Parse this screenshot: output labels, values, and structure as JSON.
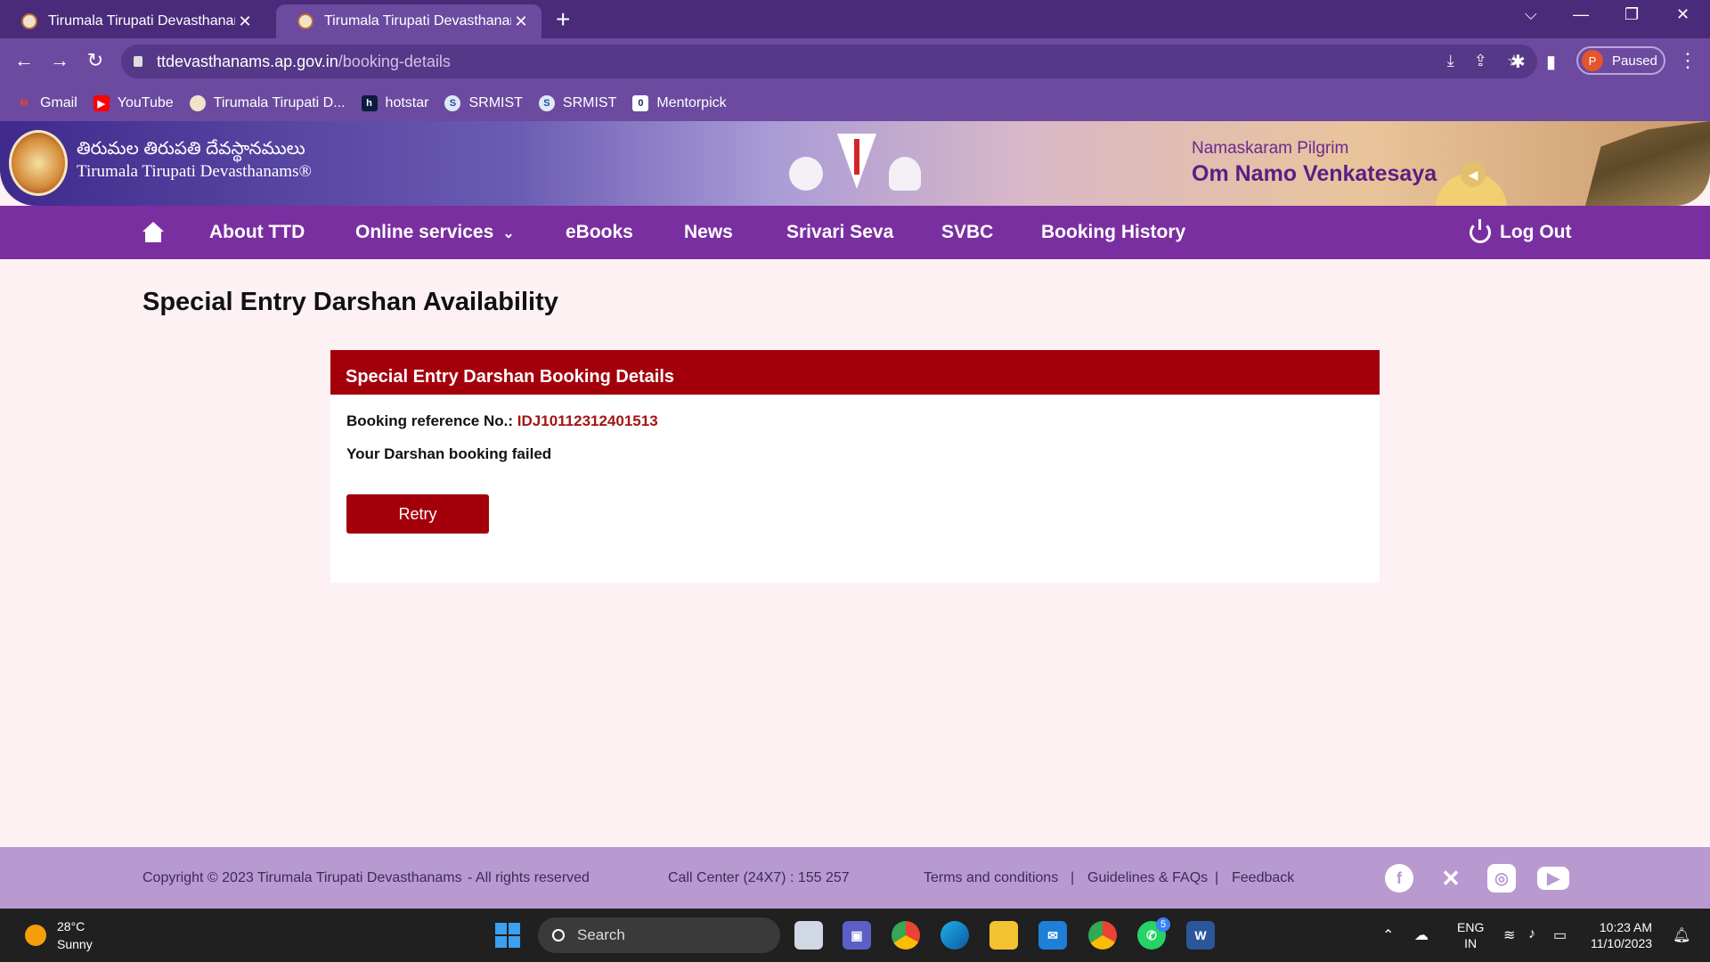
{
  "browser": {
    "tabs": [
      {
        "title": "Tirumala Tirupati Devasthanams",
        "active": false
      },
      {
        "title": "Tirumala Tirupati Devasthanams",
        "active": true
      }
    ],
    "url_host": "ttdevasthanams.ap.gov.in",
    "url_path": "/booking-details",
    "profile_initial": "P",
    "profile_status": "Paused",
    "bookmarks": [
      {
        "label": "Gmail",
        "icon": "gmail-icon"
      },
      {
        "label": "YouTube",
        "icon": "youtube-icon"
      },
      {
        "label": "Tirumala Tirupati D...",
        "icon": "ttd-icon"
      },
      {
        "label": "hotstar",
        "icon": "hotstar-icon"
      },
      {
        "label": "SRMIST",
        "icon": "srmist-icon"
      },
      {
        "label": "SRMIST",
        "icon": "srmist-icon"
      },
      {
        "label": "Mentorpick",
        "icon": "mentorpick-icon"
      }
    ]
  },
  "header": {
    "logo_telugu": "తిరుమల తిరుపతి దేవస్థానములు",
    "logo_english": "Tirumala Tirupati Devasthanams®",
    "greeting": "Namaskaram Pilgrim",
    "mantra": "Om Namo Venkatesaya"
  },
  "nav": {
    "items": [
      "About TTD",
      "Online services",
      "eBooks",
      "News",
      "Srivari Seva",
      "SVBC",
      "Booking History"
    ],
    "logout": "Log Out"
  },
  "main": {
    "page_title": "Special Entry Darshan Availability",
    "card_title": "Special Entry Darshan Booking Details",
    "ref_label": "Booking reference No.:",
    "ref_value": "IDJ10112312401513",
    "status": "Your Darshan booking failed",
    "retry_label": "Retry"
  },
  "footer": {
    "copyright": "Copyright © 2023 Tirumala Tirupati Devasthanams",
    "rights": "- All rights reserved",
    "call_center": "Call Center (24X7) : 155 257",
    "terms": "Terms and conditions",
    "guidelines": "Guidelines & FAQs",
    "feedback": "Feedback",
    "separator": "|"
  },
  "taskbar": {
    "temperature": "28°C",
    "condition": "Sunny",
    "search_placeholder": "Search",
    "lang_line1": "ENG",
    "lang_line2": "IN",
    "time": "10:23 AM",
    "date": "11/10/2023",
    "whatsapp_badge": "5"
  },
  "colors": {
    "brand_purple": "#7a2fa0",
    "card_header_red": "#a3000c",
    "ref_red": "#a31515",
    "page_bg": "#fdf1f3"
  }
}
